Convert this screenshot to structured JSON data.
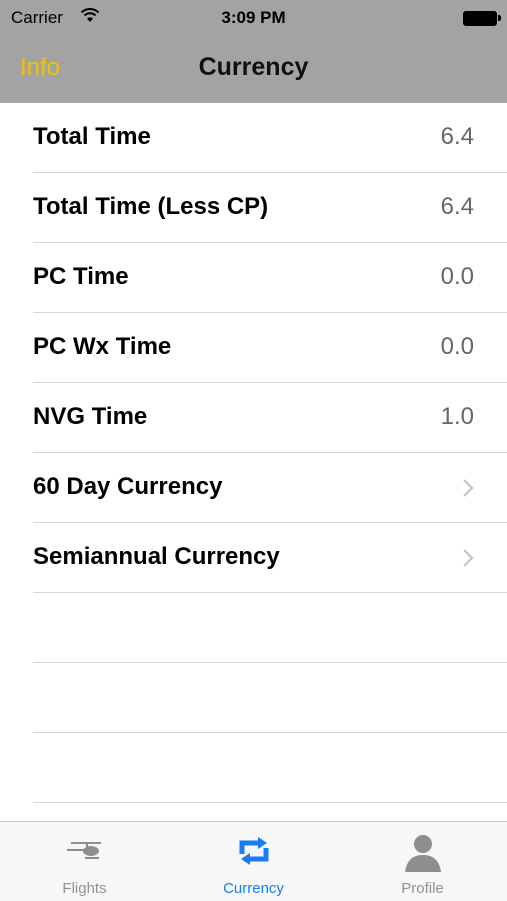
{
  "status": {
    "carrier": "Carrier",
    "time": "3:09 PM"
  },
  "nav": {
    "back_label": "Info",
    "title": "Currency"
  },
  "rows": [
    {
      "label": "Total Time",
      "value": "6.4"
    },
    {
      "label": "Total Time (Less CP)",
      "value": "6.4"
    },
    {
      "label": "PC Time",
      "value": "0.0"
    },
    {
      "label": "PC Wx Time",
      "value": "0.0"
    },
    {
      "label": "NVG Time",
      "value": "1.0"
    },
    {
      "label": "60 Day Currency",
      "icon": "chevron-right-icon"
    },
    {
      "label": "Semiannual Currency",
      "icon": "chevron-right-icon"
    }
  ],
  "tabs": [
    {
      "label": "Flights",
      "icon": "helicopter-icon",
      "active": false
    },
    {
      "label": "Currency",
      "icon": "repeat-icon",
      "active": true
    },
    {
      "label": "Profile",
      "icon": "person-icon",
      "active": false
    }
  ],
  "colors": {
    "accent": "#1a7cf2",
    "back": "#f2c200",
    "navbar": "#a3a3a3"
  }
}
